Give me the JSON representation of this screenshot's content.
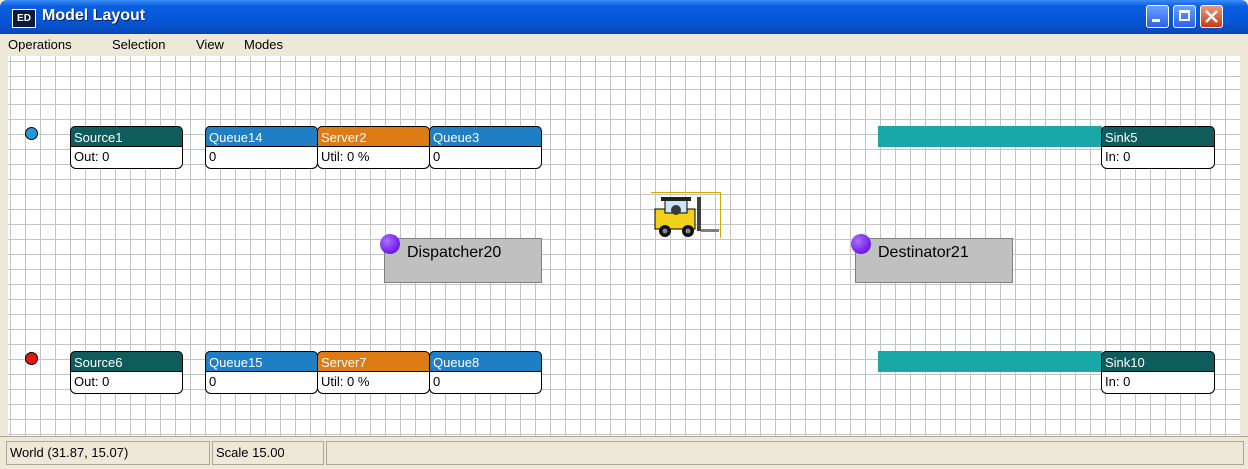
{
  "window": {
    "title": "Model Layout",
    "icon_label": "ED",
    "icon": "model-layout-app-icon"
  },
  "menu": [
    "Operations",
    "Selection",
    "View",
    "Modes"
  ],
  "row1": {
    "source": {
      "name": "Source1",
      "value": "Out: 0",
      "dot_color": "#1e9bd7"
    },
    "queue_a": {
      "name": "Queue14",
      "value": "0"
    },
    "server": {
      "name": "Server2",
      "value": "Util: 0 %"
    },
    "queue_b": {
      "name": "Queue3",
      "value": "0"
    },
    "sink": {
      "name": "Sink5",
      "value": "In: 0"
    }
  },
  "row2": {
    "source": {
      "name": "Source6",
      "value": "Out: 0",
      "dot_color": "#e01818"
    },
    "queue_a": {
      "name": "Queue15",
      "value": "0"
    },
    "server": {
      "name": "Server7",
      "value": "Util: 0 %"
    },
    "queue_b": {
      "name": "Queue8",
      "value": "0"
    },
    "sink": {
      "name": "Sink10",
      "value": "In: 0"
    }
  },
  "dispatcher": {
    "name": "Dispatcher20"
  },
  "destinator": {
    "name": "Destinator21"
  },
  "transporter": {
    "icon": "forklift-icon"
  },
  "status": {
    "world": "World (31.87, 15.07)",
    "scale": "Scale 15.00"
  },
  "colors": {
    "source_header": "#0f5c5c",
    "queue_header": "#1f7ec4",
    "server_header": "#de7b15",
    "conveyor": "#1aa7a7",
    "node_dot": "#7a22ee"
  }
}
